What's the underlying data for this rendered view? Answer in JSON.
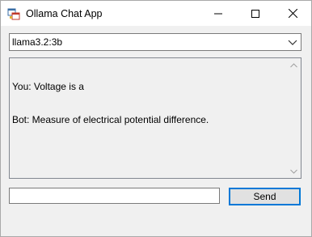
{
  "window": {
    "title": "Ollama Chat App",
    "icon": "app-window-icon"
  },
  "titlebar_controls": {
    "minimize_icon": "minimize-icon",
    "maximize_icon": "maximize-icon",
    "close_icon": "close-icon"
  },
  "model_select": {
    "selected": "llama3.2:3b",
    "icon": "chevron-down-icon"
  },
  "chat": {
    "lines": [
      "You: Voltage is a",
      "Bot: Measure of electrical potential difference."
    ]
  },
  "message_input": {
    "value": "",
    "placeholder": ""
  },
  "send_button": {
    "label": "Send"
  },
  "colors": {
    "window_bg": "#f0f0f0",
    "titlebar_bg": "#ffffff",
    "accent_border": "#0078d7",
    "button_bg": "#e1e1e1"
  }
}
